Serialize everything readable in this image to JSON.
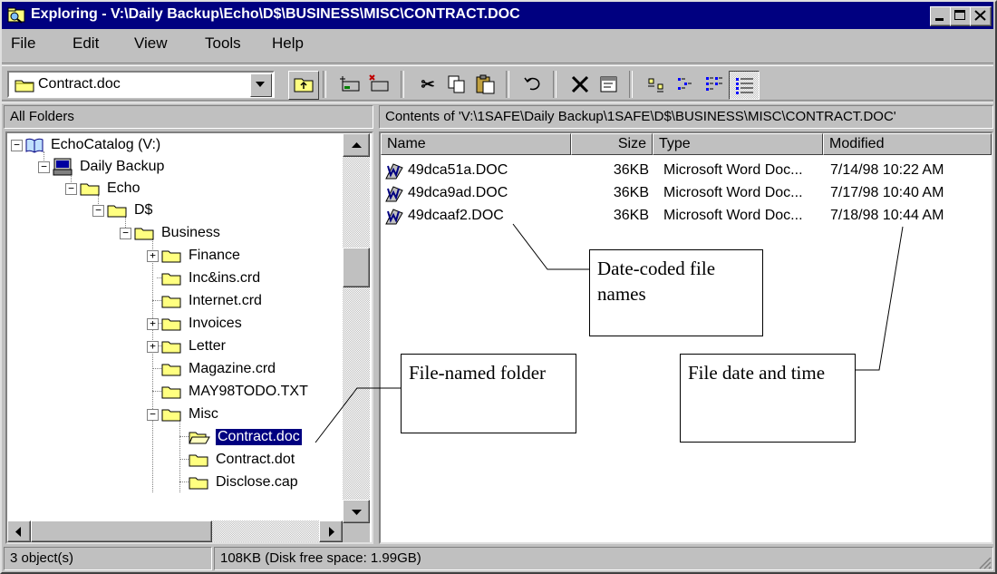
{
  "window": {
    "title": "Exploring - V:\\Daily Backup\\Echo\\D$\\BUSINESS\\MISC\\CONTRACT.DOC"
  },
  "menu": [
    "File",
    "Edit",
    "View",
    "Tools",
    "Help"
  ],
  "toolbar": {
    "address_value": "Contract.doc"
  },
  "left_pane": {
    "header": "All Folders",
    "tree": [
      {
        "label": "EchoCatalog (V:)"
      },
      {
        "label": "Daily Backup"
      },
      {
        "label": "Echo"
      },
      {
        "label": "D$"
      },
      {
        "label": "Business"
      },
      {
        "label": "Finance"
      },
      {
        "label": "Inc&ins.crd"
      },
      {
        "label": "Internet.crd"
      },
      {
        "label": "Invoices"
      },
      {
        "label": "Letter"
      },
      {
        "label": "Magazine.crd"
      },
      {
        "label": "MAY98TODO.TXT"
      },
      {
        "label": "Misc"
      },
      {
        "label": "Contract.doc"
      },
      {
        "label": "Contract.dot"
      },
      {
        "label": "Disclose.cap"
      }
    ]
  },
  "right_pane": {
    "header": "Contents of 'V:\\1SAFE\\Daily Backup\\1SAFE\\D$\\BUSINESS\\MISC\\CONTRACT.DOC'",
    "columns": [
      "Name",
      "Size",
      "Type",
      "Modified"
    ],
    "files": [
      {
        "name": "49dca51a.DOC",
        "size": "36KB",
        "type": "Microsoft Word Doc...",
        "modified": "7/14/98 10:22 AM"
      },
      {
        "name": "49dca9ad.DOC",
        "size": "36KB",
        "type": "Microsoft Word Doc...",
        "modified": "7/17/98 10:40 AM"
      },
      {
        "name": "49dcaaf2.DOC",
        "size": "36KB",
        "type": "Microsoft Word Doc...",
        "modified": "7/18/98 10:44 AM"
      }
    ]
  },
  "status": {
    "objects": "3 object(s)",
    "size": "108KB (Disk free space: 1.99GB)"
  },
  "callouts": {
    "date_coded": "Date-coded file names",
    "file_named_folder": "File-named folder",
    "file_date": "File date and time"
  }
}
